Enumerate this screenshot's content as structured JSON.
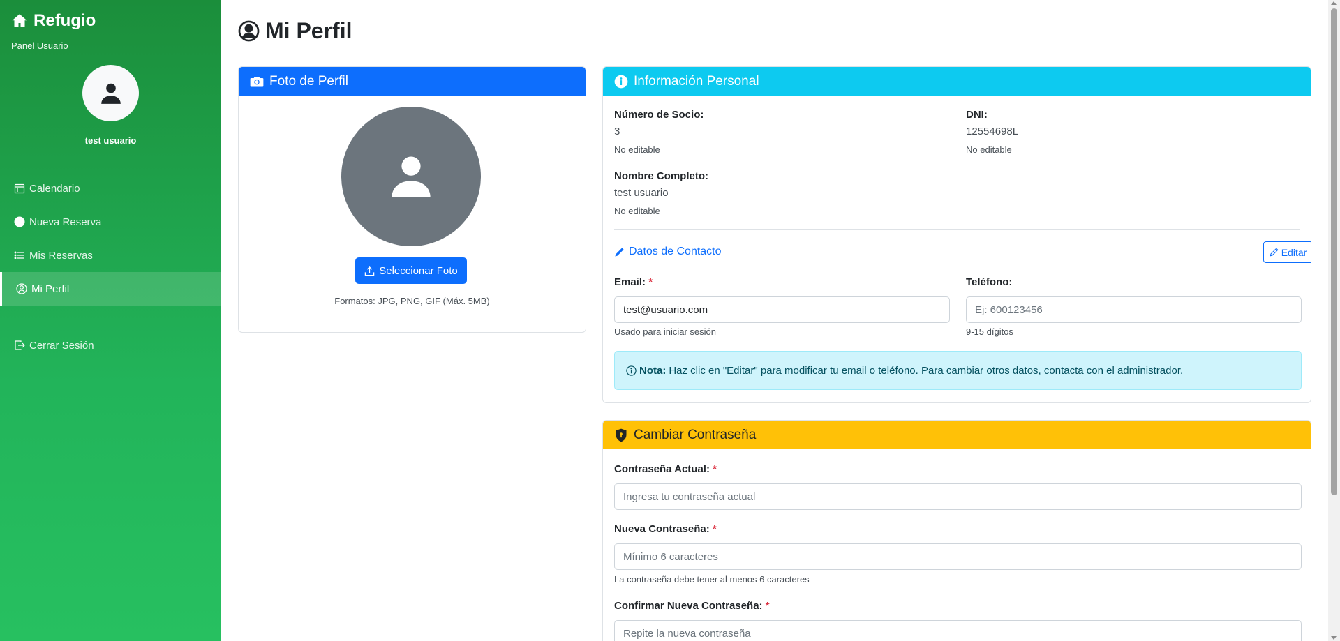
{
  "sidebar": {
    "brand": "Refugio",
    "subtitle": "Panel Usuario",
    "username": "test usuario",
    "nav": [
      {
        "label": "Calendario",
        "icon": "calendar-icon"
      },
      {
        "label": "Nueva Reserva",
        "icon": "plus-circle-icon"
      },
      {
        "label": "Mis Reservas",
        "icon": "list-icon"
      },
      {
        "label": "Mi Perfil",
        "icon": "person-circle-icon"
      }
    ],
    "logout": "Cerrar Sesión"
  },
  "page": {
    "title": "Mi Perfil"
  },
  "photo": {
    "header": "Foto de Perfil",
    "button": "Seleccionar Foto",
    "formats": "Formatos: JPG, PNG, GIF (Máx. 5MB)"
  },
  "info": {
    "header": "Información Personal",
    "socio_label": "Número de Socio:",
    "socio_value": "3",
    "socio_note": "No editable",
    "dni_label": "DNI:",
    "dni_value": "12554698L",
    "dni_note": "No editable",
    "name_label": "Nombre Completo:",
    "name_value": "test usuario",
    "name_note": "No editable",
    "contact_title": "Datos de Contacto",
    "edit_button": "Editar",
    "email_label": "Email:",
    "email_value": "test@usuario.com",
    "email_help": "Usado para iniciar sesión",
    "phone_label": "Teléfono:",
    "phone_placeholder": "Ej: 600123456",
    "phone_help": "9-15 dígitos",
    "note_bold": "Nota:",
    "note_text": "Haz clic en \"Editar\" para modificar tu email o teléfono. Para cambiar otros datos, contacta con el administrador."
  },
  "password": {
    "header": "Cambiar Contraseña",
    "current_label": "Contraseña Actual:",
    "current_placeholder": "Ingresa tu contraseña actual",
    "new_label": "Nueva Contraseña:",
    "new_placeholder": "Mínimo 6 caracteres",
    "new_help": "La contraseña debe tener al menos 6 caracteres",
    "confirm_label": "Confirmar Nueva Contraseña:",
    "confirm_placeholder": "Repite la nueva contraseña",
    "required_mark": "*"
  },
  "colors": {
    "sidebar": "#1b8e3b",
    "primary": "#0d6efd",
    "info": "#0dcaf0",
    "warning": "#ffc107"
  }
}
